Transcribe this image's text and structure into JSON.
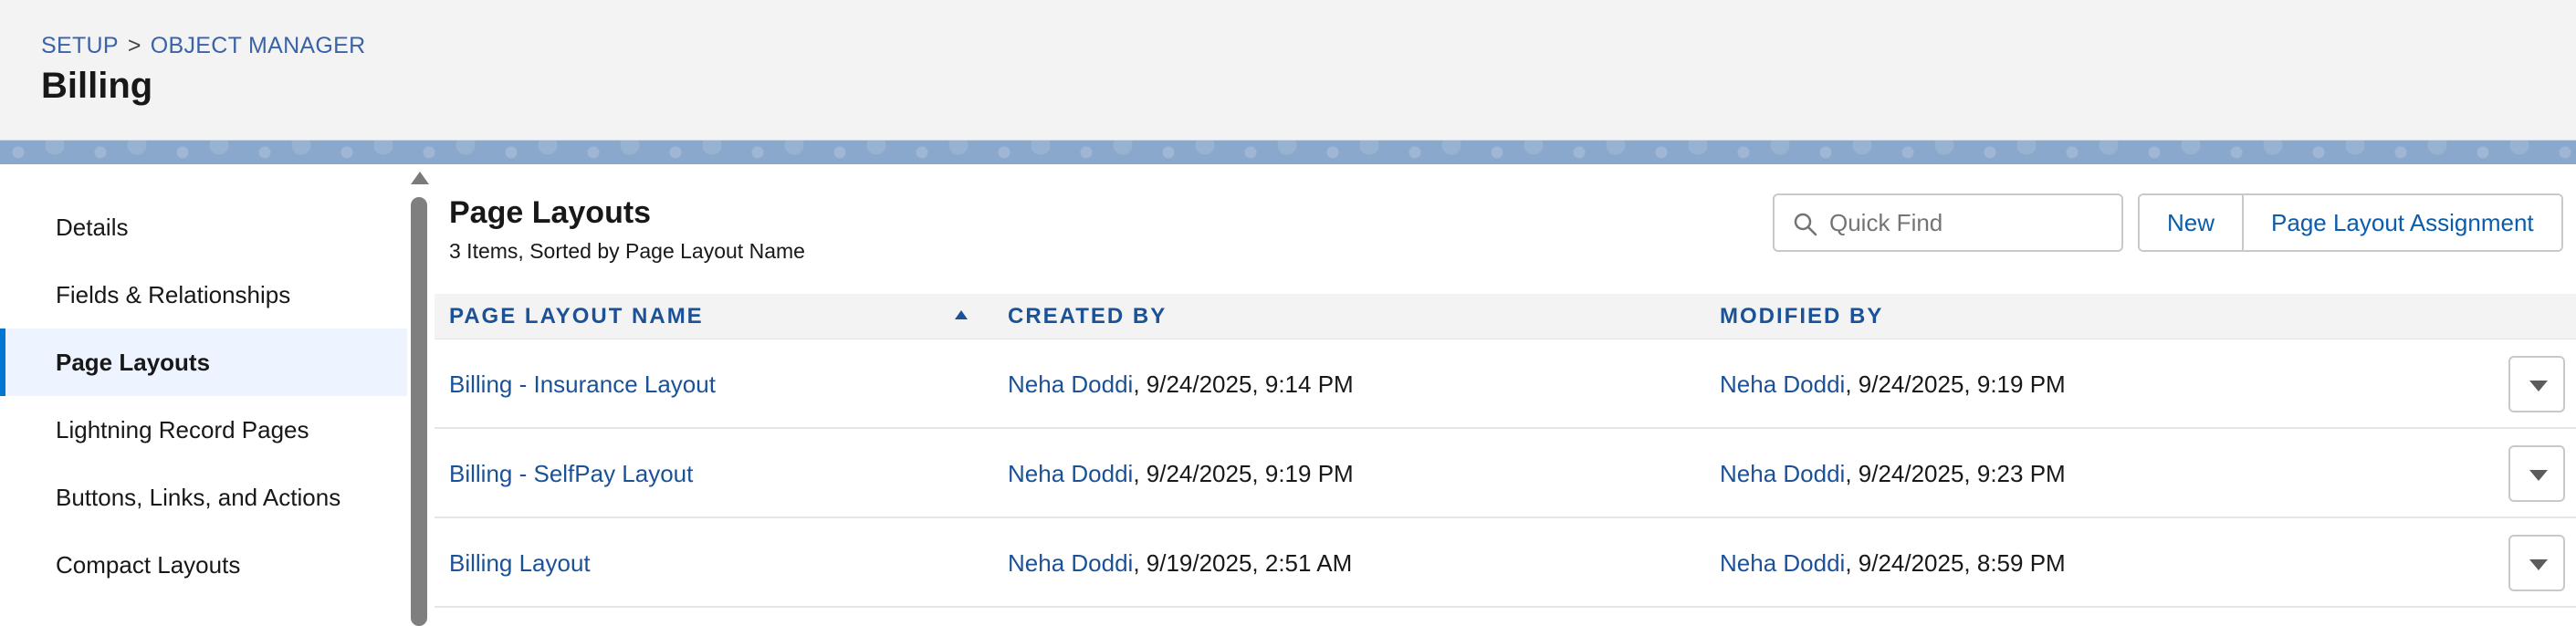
{
  "header": {
    "breadcrumb": [
      "SETUP",
      "OBJECT MANAGER"
    ],
    "breadcrumb_separator": ">",
    "title": "Billing"
  },
  "sidebar": {
    "items": [
      {
        "label": "Details",
        "active": false
      },
      {
        "label": "Fields & Relationships",
        "active": false
      },
      {
        "label": "Page Layouts",
        "active": true
      },
      {
        "label": "Lightning Record Pages",
        "active": false
      },
      {
        "label": "Buttons, Links, and Actions",
        "active": false
      },
      {
        "label": "Compact Layouts",
        "active": false
      }
    ]
  },
  "main": {
    "title": "Page Layouts",
    "subtitle": "3 Items, Sorted by Page Layout Name",
    "search": {
      "placeholder": "Quick Find",
      "value": "",
      "icon": "search-icon"
    },
    "buttons": {
      "new": "New",
      "assignment": "Page Layout Assignment"
    },
    "table": {
      "columns": [
        "PAGE LAYOUT NAME",
        "CREATED BY",
        "MODIFIED BY"
      ],
      "sort_column": "PAGE LAYOUT NAME",
      "sort_direction": "ascending",
      "rows": [
        {
          "name": "Billing - Insurance Layout",
          "created_user": "Neha Doddi",
          "created_date": ", 9/24/2025, 9:14 PM",
          "modified_user": "Neha Doddi",
          "modified_date": ", 9/24/2025, 9:19 PM"
        },
        {
          "name": "Billing - SelfPay Layout",
          "created_user": "Neha Doddi",
          "created_date": ", 9/24/2025, 9:19 PM",
          "modified_user": "Neha Doddi",
          "modified_date": ", 9/24/2025, 9:23 PM"
        },
        {
          "name": "Billing Layout",
          "created_user": "Neha Doddi",
          "created_date": ", 9/19/2025, 2:51 AM",
          "modified_user": "Neha Doddi",
          "modified_date": ", 9/24/2025, 8:59 PM"
        }
      ]
    }
  },
  "colors": {
    "link": "#1b5297",
    "active_bg": "#eef4ff",
    "banner": "#8aa7cc"
  }
}
